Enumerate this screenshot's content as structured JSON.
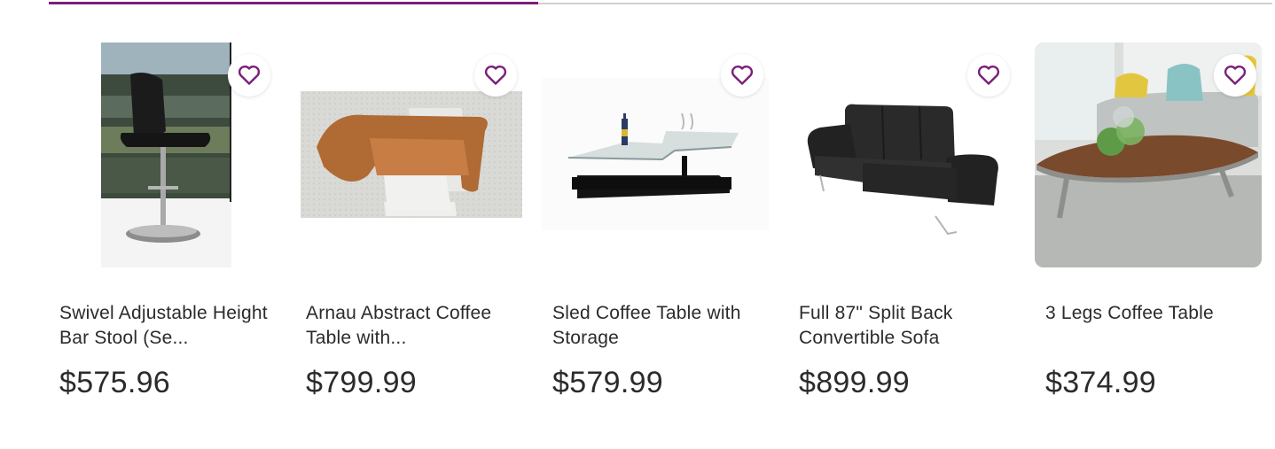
{
  "carousel": {
    "progress_fraction": 0.4,
    "accent_color": "#7b1f7a",
    "products": [
      {
        "title": "Swivel Adjustable Height Bar Stool (Se...",
        "price": "$575.96",
        "image": "bar-stool-image"
      },
      {
        "title": "Arnau Abstract Coffee Table with...",
        "price": "$799.99",
        "image": "wooden-coffee-table-image"
      },
      {
        "title": "Sled Coffee Table with Storage",
        "price": "$579.99",
        "image": "glass-coffee-table-image"
      },
      {
        "title": "Full 87\" Split Back Convertible Sofa",
        "price": "$899.99",
        "image": "black-sofa-image"
      },
      {
        "title": "3 Legs Coffee Table",
        "price": "$374.99",
        "image": "three-legs-table-image"
      }
    ]
  }
}
